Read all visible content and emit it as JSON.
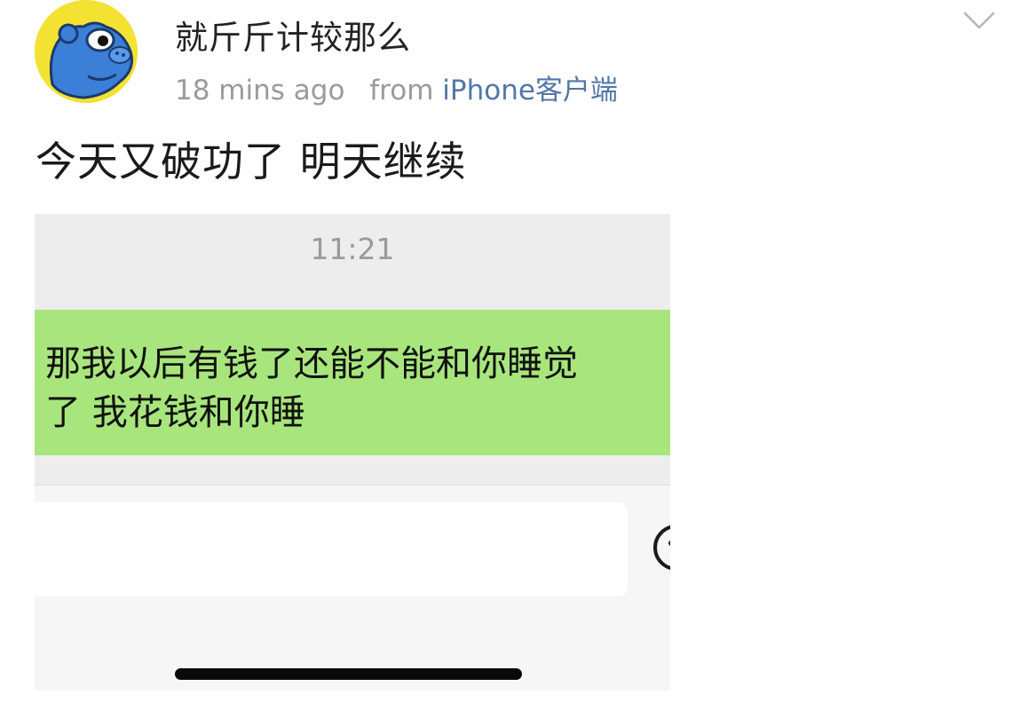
{
  "post": {
    "username": "就斤斤计较那么",
    "time": "18 mins ago",
    "from_label": "from",
    "source": "iPhone客户端",
    "text": "今天又破功了 明天继续"
  },
  "screenshot": {
    "chat_time": "11:21",
    "message_line1": "那我以后有钱了还能不能和你睡觉",
    "message_line2": "了 我花钱和你睡"
  },
  "icons": {
    "avatar": "cartoon-hippo-avatar",
    "more": "chevron-down-icon",
    "emoji": "emoji-icon"
  },
  "colors": {
    "link": "#5177a8",
    "bubble": "#a8e67d",
    "avatar_bg": "#f3e232"
  }
}
